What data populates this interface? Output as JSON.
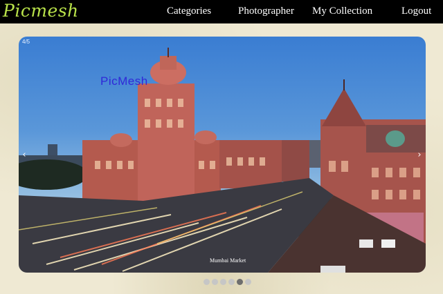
{
  "brand": {
    "logo": "Picmesh",
    "logo_color": "#b9e24a"
  },
  "nav": {
    "categories": "Categories",
    "photographer": "Photographer",
    "my_collection": "My Collection",
    "logout": "Logout"
  },
  "slider": {
    "counter": "4/5",
    "watermark": "PicMesh",
    "caption": "Mumbai Market",
    "prev_icon": "chevron-left-icon",
    "next_icon": "chevron-right-icon",
    "prev_glyph": "‹",
    "next_glyph": "›",
    "total_slides": 6,
    "active_slide": 5
  },
  "colors": {
    "navbar_bg": "#000000",
    "page_bg": "#efe9d3",
    "watermark": "#2f28d8",
    "dot_active": "#6e6e6e",
    "dot_inactive": "#c6c6c6"
  }
}
